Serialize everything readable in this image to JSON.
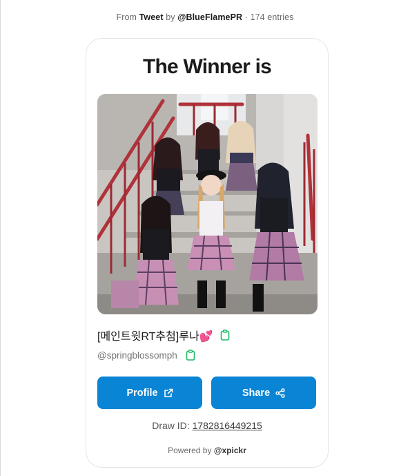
{
  "source": {
    "prefix": "From",
    "platform": "Tweet",
    "by": "by",
    "account": "@BlueFlamePR",
    "entries": "· 174 entries"
  },
  "card": {
    "title": "The Winner is",
    "winner": {
      "display_name": "[메인트윗RT추첨]루나",
      "emoji": "💕",
      "handle": "@springblossomph"
    },
    "buttons": {
      "profile_label": "Profile",
      "share_label": "Share"
    },
    "draw_id_label": "Draw ID:",
    "draw_id_value": "1782816449215",
    "powered_prefix": "Powered by",
    "powered_brand": "@xpickr"
  },
  "icons": {
    "copy": "clipboard-icon",
    "external": "external-link-icon",
    "share": "share-nodes-icon"
  },
  "colors": {
    "primary": "#0a84d4",
    "copy_icon": "#1fb86b"
  }
}
